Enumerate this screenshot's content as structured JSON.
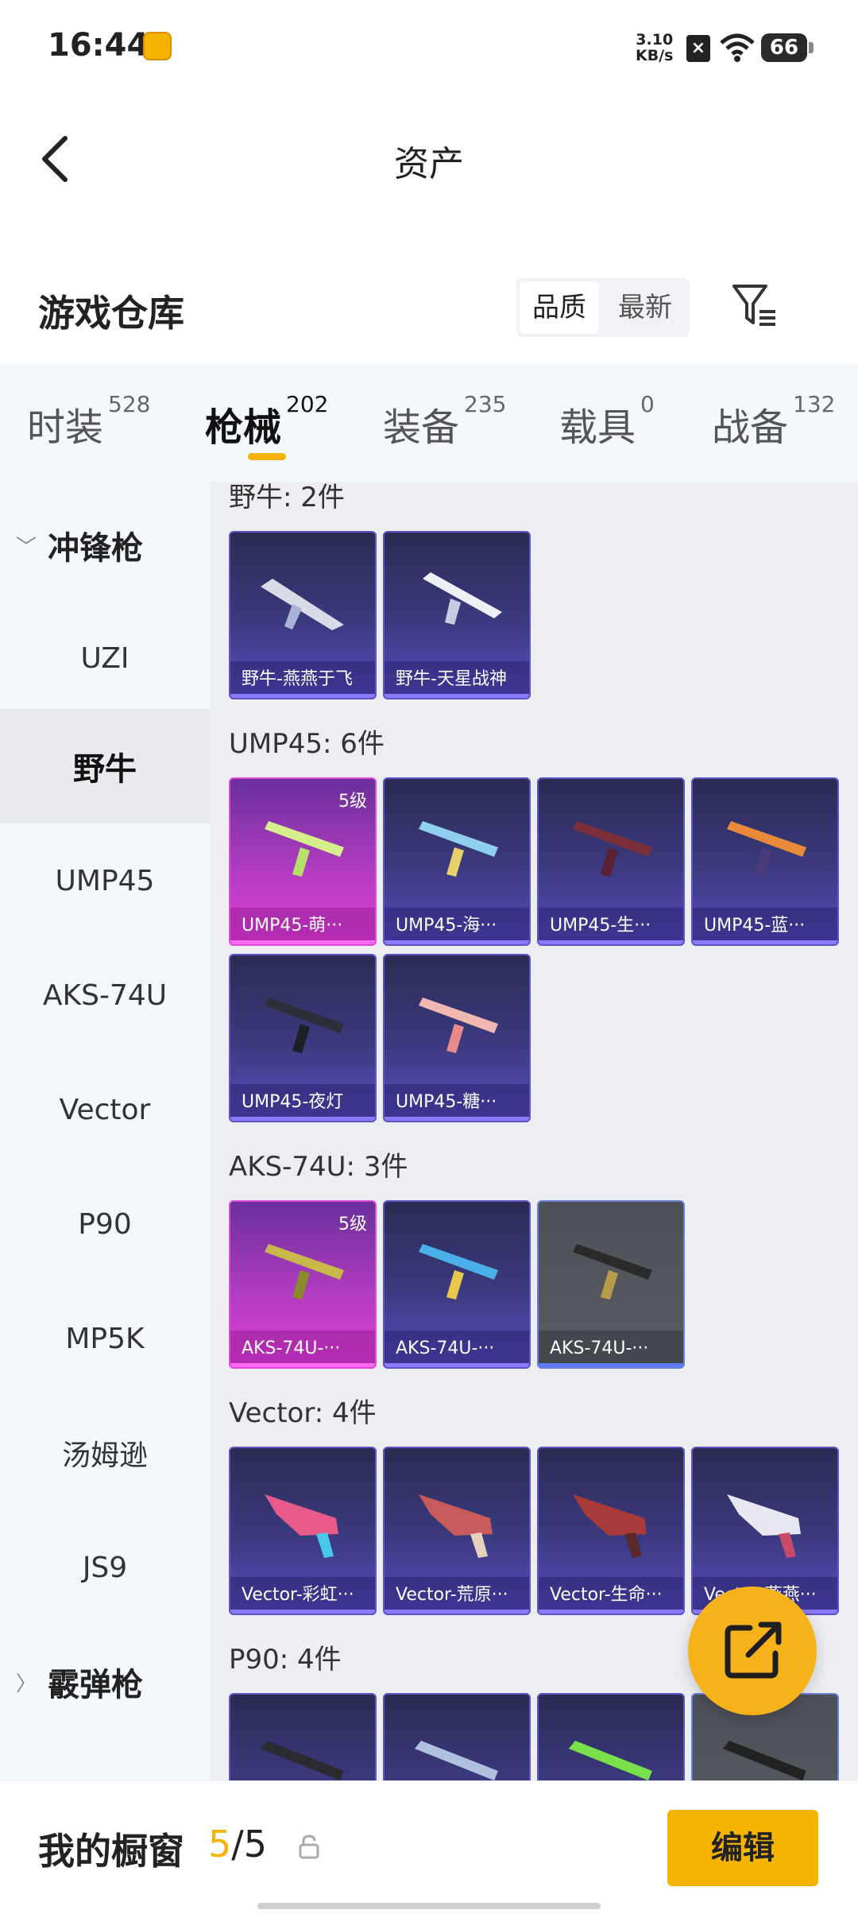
{
  "status_bar": {
    "time": "16:44",
    "net_speed_value": "3.10",
    "net_speed_unit": "KB/s",
    "battery": "66"
  },
  "header": {
    "title": "资产"
  },
  "warehouse": {
    "title": "游戏仓库",
    "sort_quality": "品质",
    "sort_newest": "最新"
  },
  "tabs": [
    {
      "label": "时装",
      "count": "528"
    },
    {
      "label": "枪械",
      "count": "202"
    },
    {
      "label": "装备",
      "count": "235"
    },
    {
      "label": "载具",
      "count": "0"
    },
    {
      "label": "战备",
      "count": "132"
    }
  ],
  "sidebar": {
    "category_open": "冲锋枪",
    "items": [
      "UZI",
      "野牛",
      "UMP45",
      "AKS-74U",
      "Vector",
      "P90",
      "MP5K",
      "汤姆逊",
      "JS9"
    ],
    "category_closed": "霰弹枪"
  },
  "sections": [
    {
      "title": "野牛: 2件",
      "items": [
        {
          "name": "野牛-燕燕于飞",
          "level": ""
        },
        {
          "name": "野牛-天星战神",
          "level": ""
        }
      ]
    },
    {
      "title": "UMP45: 6件",
      "items": [
        {
          "name": "UMP45-萌···",
          "level": "5级"
        },
        {
          "name": "UMP45-海···",
          "level": ""
        },
        {
          "name": "UMP45-生···",
          "level": ""
        },
        {
          "name": "UMP45-蓝···",
          "level": ""
        },
        {
          "name": "UMP45-夜灯",
          "level": ""
        },
        {
          "name": "UMP45-糖···",
          "level": ""
        }
      ]
    },
    {
      "title": "AKS-74U: 3件",
      "items": [
        {
          "name": "AKS-74U-···",
          "level": "5级"
        },
        {
          "name": "AKS-74U-···",
          "level": ""
        },
        {
          "name": "AKS-74U-···",
          "level": ""
        }
      ]
    },
    {
      "title": "Vector: 4件",
      "items": [
        {
          "name": "Vector-彩虹···",
          "level": ""
        },
        {
          "name": "Vector-荒原···",
          "level": ""
        },
        {
          "name": "Vector-生命···",
          "level": ""
        },
        {
          "name": "Vector-燕燕···",
          "level": ""
        }
      ]
    },
    {
      "title": "P90: 4件",
      "items": []
    }
  ],
  "bottom_bar": {
    "label": "我的橱窗",
    "current": "5",
    "separator": "/",
    "total": "5",
    "edit": "编辑"
  },
  "icons": {
    "back": "chevron-left-icon",
    "filter": "filter-icon",
    "share": "share-icon",
    "lock": "lock-icon"
  },
  "colors": {
    "accent": "#f5b400",
    "card_purple": "#3b3a80",
    "card_pink": "#e040d6",
    "card_gray": "#5a5c64"
  }
}
